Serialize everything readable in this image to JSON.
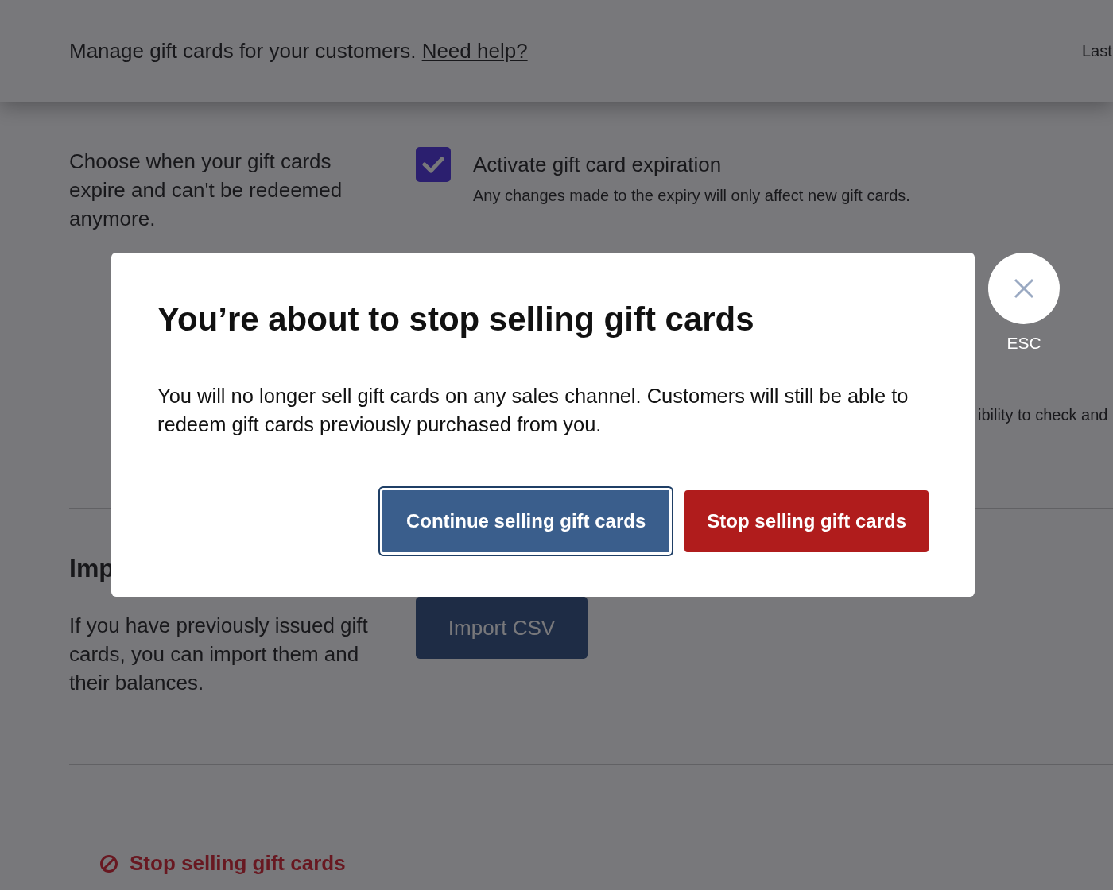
{
  "header": {
    "description": "Manage gift cards for your customers.",
    "help_link": "Need help?",
    "right_text": "Last"
  },
  "expiry_section": {
    "description": "Choose when your gift cards expire and can't be redeemed anymore.",
    "checkbox": {
      "label": "Activate gift card expiration",
      "checked": true,
      "hint": "Any changes made to the expiry will only affect new gift cards."
    },
    "partial_text": "ibility to check and"
  },
  "import_section": {
    "heading": "Imp",
    "description": "If you have previously issued gift cards, you can import them and their balances.",
    "button": "Import CSV"
  },
  "stop_link": "Stop selling gift cards",
  "modal": {
    "title": "You’re about to stop selling gift cards",
    "body": "You will no longer sell gift cards on any sales channel. Customers will still be able to redeem gift cards previously purchased from you.",
    "buttons": [
      {
        "label": "Continue selling gift cards",
        "kind": "secondary",
        "focused": true
      },
      {
        "label": "Stop selling gift cards",
        "kind": "danger",
        "focused": false
      }
    ]
  },
  "close_button": {
    "label": "ESC"
  }
}
